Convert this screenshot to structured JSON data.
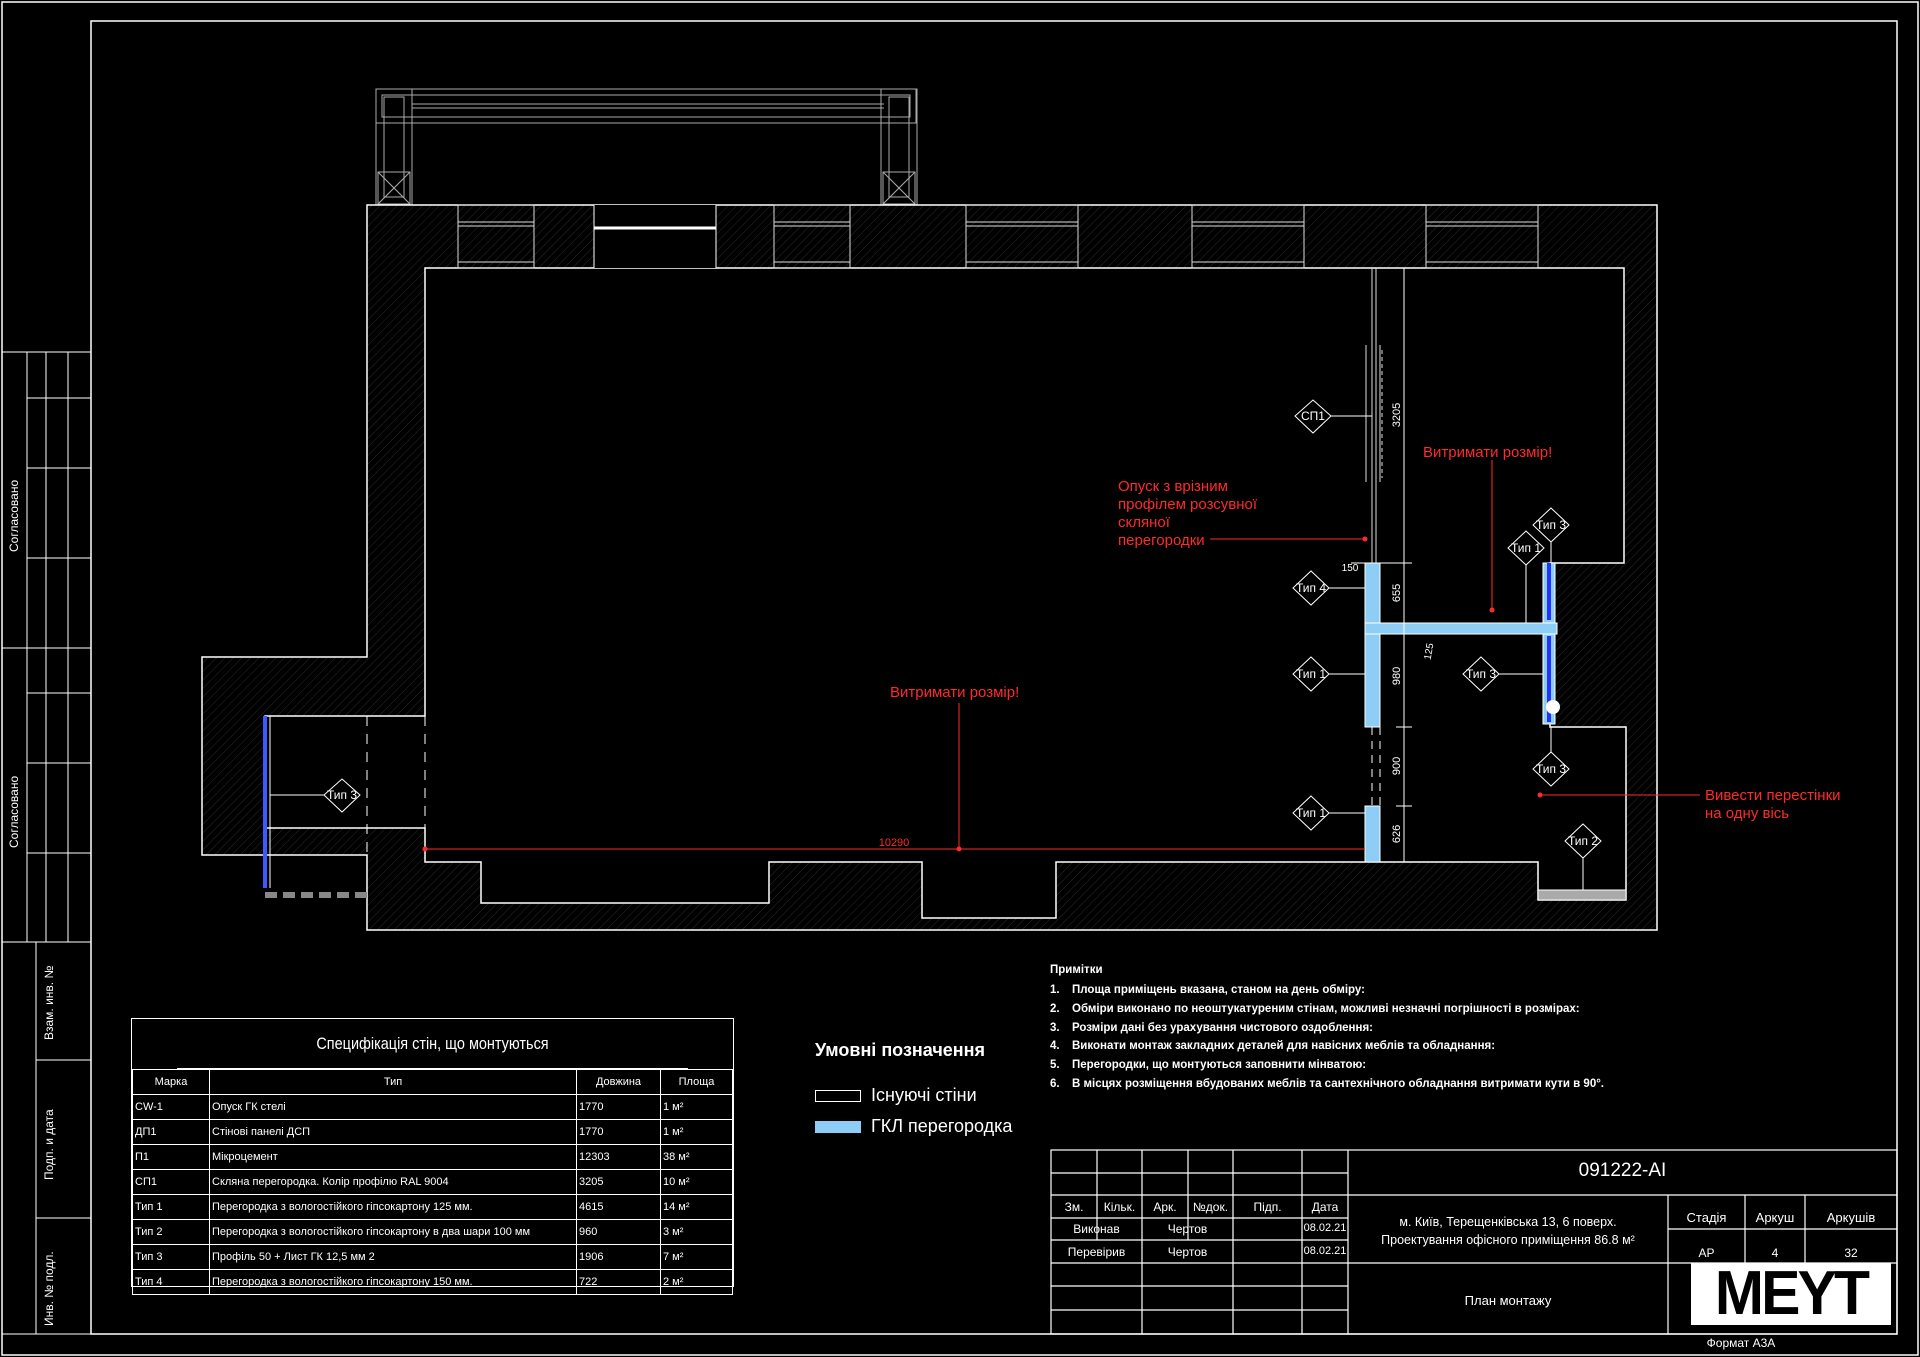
{
  "plan": {
    "labels": {
      "sp1": "СП1",
      "tip1a": "Тип 1",
      "tip1b": "Тип 1",
      "tip1c": "Тип 1",
      "tip4": "Тип 4",
      "tip3a": "Тип 3",
      "tip3b": "Тип 3",
      "tip3c": "Тип 3",
      "tip3d": "Тип 3",
      "tip2": "Тип 2"
    },
    "dimensions": {
      "d3205": "3205",
      "d150": "150",
      "d655": "655",
      "d125": "125",
      "d980": "980",
      "d900": "900",
      "d626": "626",
      "d10290": "10290"
    },
    "annotations": {
      "keep_size_1": "Витримати розмір!",
      "keep_size_2": "Витримати розмір!",
      "opusk_l1": "Опуск з врізним",
      "opusk_l2": "профілем розсувної",
      "opusk_l3": "скляної",
      "opusk_l4": "перегородки",
      "axis_l1": "Вивести перестінки",
      "axis_l2": "на одну вісь"
    }
  },
  "spec": {
    "title": "Специфікація стін, що монтуються",
    "headers": [
      "Марка",
      "Тип",
      "Довжина",
      "Площа"
    ],
    "rows": [
      [
        "CW-1",
        "Опуск ГК стелі",
        "1770",
        "1 м²"
      ],
      [
        "ДП1",
        "Стінові панелі ДСП",
        "1770",
        "1 м²"
      ],
      [
        "П1",
        "Мікроцемент",
        "12303",
        "38 м²"
      ],
      [
        "СП1",
        "Скляна перегородка. Колір профілю RAL 9004",
        "3205",
        "10 м²"
      ],
      [
        "Тип 1",
        "Перегородка з вологостійкого гіпсокартону 125 мм.",
        "4615",
        "14 м²"
      ],
      [
        "Тип 2",
        "Перегородка з вологостійкого гіпсокартону в два шари 100 мм",
        "960",
        "3 м²"
      ],
      [
        "Тип 3",
        "Профіль 50 + Лист ГК 12,5 мм 2",
        "1906",
        "7 м²"
      ],
      [
        "Тип 4",
        "Перегородка з вологостійкого гіпсокартону 150 мм.",
        "722",
        "2 м²"
      ]
    ]
  },
  "legend": {
    "title": "Умовні позначення",
    "existing": "Існуючі стіни",
    "gkl": "ГКЛ перегородка",
    "colors": {
      "existing": "#ffffff",
      "gkl": "#8ecdf5"
    }
  },
  "notes": {
    "title": "Примітки",
    "items": [
      "Площа приміщень вказана, станом на день обміру:",
      "Обміри виконано по неоштукатуреним стінам, можливі незначні погрішності в розмірах:",
      "Розміри дані без урахування чистового оздоблення:",
      "Виконати монтаж закладних деталей для навісних меблів та обладнання:",
      "Перегородки, що монтуються заповнити мінватою:",
      "В місцях розміщення вбудованих меблів та сантехнічного обладнання витримати кути в 90°."
    ]
  },
  "title_block": {
    "code": "091222-АІ",
    "headers": [
      "Зм.",
      "Кільк.",
      "Арк.",
      "№док.",
      "Підп.",
      "Дата"
    ],
    "row1": [
      "Виконав",
      "Чертов",
      "08.02.21"
    ],
    "row2": [
      "Перевірив",
      "Чертов",
      "08.02.21"
    ],
    "address": "м. Київ, Терещенківська 13, 6 поверх.",
    "project": "Проектування офісного приміщення 86.8 м²",
    "stage_h": "Стадія",
    "sheet_h": "Аркуш",
    "sheets_h": "Аркушів",
    "stage": "АР",
    "sheet": "4",
    "sheets": "32",
    "drawing_name": "План монтажу",
    "logo": "MEYT",
    "format": "Формат А3А"
  },
  "side": {
    "agreed1": "Согласовано",
    "agreed2": "Согласовано",
    "inv_replace": "Взам. инв. №",
    "sign_date": "Подп. и дата",
    "inv_orig": "Инв. № подл."
  }
}
